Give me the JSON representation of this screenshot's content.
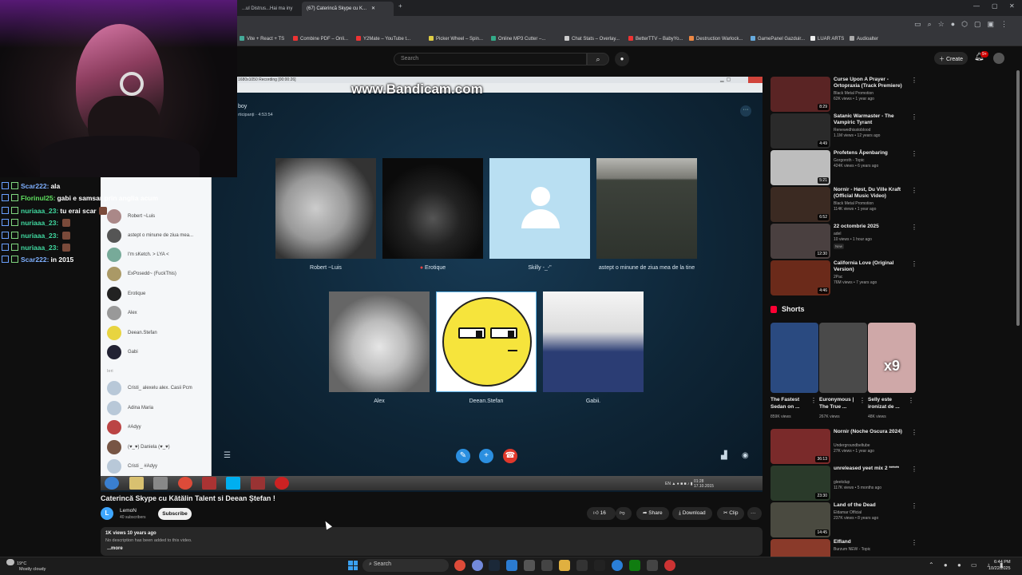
{
  "browser": {
    "tabs": [
      {
        "label": "...ul Distrus...Hai ma iny",
        "active": false
      },
      {
        "label": "(67) Caterincă Skype cu K...",
        "active": true
      }
    ],
    "bookmarks": [
      "Vite + React + TS",
      "Combine PDF – Onli...",
      "Y2Mate – YouTube t...",
      "Picker Wheel – Spin...",
      "Online MP3 Cutter –...",
      "Chat Stats – Overlay...",
      "BetterTTV – BabyYo...",
      "Destruction Warlock...",
      "GamePanel Gazduir...",
      "LUAR ARTS",
      "Audioalter"
    ]
  },
  "youtube": {
    "search_placeholder": "Search",
    "create_label": "Create",
    "notif_count": "9+"
  },
  "chat": [
    {
      "user": "Scar222:",
      "text": "ala",
      "color": "#7fb0ff"
    },
    {
      "user": "Florinul25:",
      "text": "gabi e samsar prin anglia acum",
      "color": "#5fe05f"
    },
    {
      "user": "nuriaaa_23:",
      "text": "tu erai scar",
      "color": "#40d9a0"
    },
    {
      "user": "nuriaaa_23:",
      "text": "",
      "color": "#40d9a0"
    },
    {
      "user": "nuriaaa_23:",
      "text": "",
      "color": "#40d9a0"
    },
    {
      "user": "nuriaaa_23:",
      "text": "",
      "color": "#40d9a0"
    },
    {
      "user": "Scar222:",
      "text": "in 2015",
      "color": "#7fb0ff"
    }
  ],
  "skype": {
    "watermark": "www.Bandicam.com",
    "title_bar": "1680x1050   Recording [00:00:26]",
    "call_name": "boy",
    "call_sub": "rticipanți · 4:53:54",
    "participants_row1": [
      {
        "name": "Robert ~Luis"
      },
      {
        "name": "Erotique"
      },
      {
        "name": "Skilly -_-\""
      },
      {
        "name": "astept o minune  de ziua mea de la tine"
      }
    ],
    "participants_row2": [
      {
        "name": "Alex"
      },
      {
        "name": "Deean.Stefan"
      },
      {
        "name": "Gabii."
      }
    ],
    "contacts": [
      "Robert ~Luis",
      "astept o minune  de ziua mea...",
      "I'm sKetch. > LYA <",
      "ExPosedd~ (FuckThis)",
      "Erotique",
      "Alex",
      "Deean.Stefan",
      "Gabi"
    ],
    "contacts_section": "Ieri",
    "contacts_more": [
      "Cristi_ alexelu alex. Casii Pcm",
      "Adina Maria",
      "#Adyy",
      "(♥_♥) Daniela (♥_♥)",
      "Cristi _ #Adyy"
    ],
    "tray_lang": "EN",
    "tray_time": "01:28",
    "tray_date": "17.10.2015"
  },
  "video": {
    "title": "Caterincă Skype cu Kătălin Talent si Deean Ștefan !",
    "channel": "LemoN",
    "subscribers": "40 subscribers",
    "channel_initial": "L",
    "subscribe_label": "Subscribe",
    "likes": "16",
    "share_label": "Share",
    "download_label": "Download",
    "clip_label": "Clip",
    "views_line": "1K views  10 years ago",
    "description": "No description has been added to this video.",
    "more_label": "...more"
  },
  "recommendations": [
    {
      "title": "Curse Upon A Prayer - Ortopraxia (Track Premiere)",
      "channel": "Black Metal Promotion",
      "meta": "62K views • 1 year ago",
      "duration": "8:29",
      "color": "#5a2424"
    },
    {
      "title": "Satanic Warmaster - The Vampiric Tyrant",
      "channel": "Renewedhisstoblood",
      "meta": "1.1M views • 12 years ago",
      "duration": "4:49",
      "color": "#2a2a2a"
    },
    {
      "title": "Profetens Åpenbaring",
      "channel": "Gorgoroth - Topic",
      "meta": "424K views • 6 years ago",
      "duration": "5:21",
      "color": "#bdbdbd"
    },
    {
      "title": "Nornir - Høst, Du Ville Kraft (Official Music Video)",
      "channel": "Black Metal Promotion",
      "meta": "114K views • 1 year ago",
      "duration": "6:52",
      "color": "#3b2a22"
    },
    {
      "title": "22 octombrie 2025",
      "channel": "adel",
      "meta": "10 views • 1 hour ago",
      "duration": "12:30",
      "color": "#4a4040",
      "new": "New"
    },
    {
      "title": "California Love (Original Version)",
      "channel": "2Pac",
      "meta": "76M views • 7 years ago",
      "duration": "4:46",
      "color": "#6b2a1a"
    }
  ],
  "shorts_title": "Shorts",
  "shorts": [
    {
      "title": "The Fastest Sedan on ...",
      "views": "859K views",
      "color": "#2a4a80"
    },
    {
      "title": "Euronymous | The True ...",
      "views": "267K views",
      "color": "#4a4a4a"
    },
    {
      "title": "Selly este ironizat de ...",
      "views": "48K views",
      "color": "#cfa8a8",
      "overlay": "x9"
    }
  ],
  "recommendations2": [
    {
      "title": "Nornir (Noche Oscura 2024)",
      "channel": "Undergroundbeltube",
      "meta": "27K views • 1 year ago",
      "duration": "36:13",
      "color": "#7a2a2a"
    },
    {
      "title": "unreleased yeet mix 2 *****",
      "channel": "gleekdup",
      "meta": "117K views • 5 months ago",
      "duration": "23:30",
      "color": "#2a3a2a"
    },
    {
      "title": "Land of the Dead",
      "channel": "Eldamar Official",
      "meta": "237K views • 8 years ago",
      "duration": "14:45",
      "color": "#4a4a40"
    },
    {
      "title": "Elfland",
      "channel": "Burzum NEW - Topic",
      "meta": "",
      "duration": "",
      "color": "#8a3a2a"
    }
  ],
  "taskbar": {
    "weather_temp": "19°C",
    "weather_desc": "Mostly cloudy",
    "search_label": "Search",
    "time": "6:44 PM",
    "date": "10/22/2025"
  }
}
